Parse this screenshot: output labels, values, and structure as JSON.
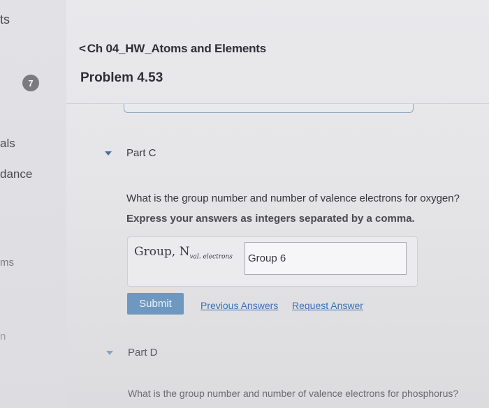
{
  "sidebar": {
    "items": [
      "ts",
      "als",
      "dance",
      "ms",
      "n"
    ],
    "badge": "7"
  },
  "header": {
    "breadcrumb_chevron": "<",
    "breadcrumb": "Ch 04_HW_Atoms and Elements",
    "problem_title": "Problem 4.53"
  },
  "partC": {
    "label": "Part C",
    "question": "What is the group number and number of valence electrons for oxygen?",
    "instruction": "Express your answers as integers separated by a comma.",
    "answer_label_main": "Group, N",
    "answer_label_sub": "val. electrons",
    "answer_value": "Group 6",
    "submit_label": "Submit",
    "previous_answers_label": "Previous Answers",
    "request_answer_label": "Request Answer"
  },
  "partD": {
    "label": "Part D",
    "question": "What is the group number and number of valence electrons for phosphorus?"
  },
  "colors": {
    "accent_blue": "#6e98bf",
    "link_blue": "#3a6fb0",
    "caret_blue": "#4a6f9d"
  }
}
